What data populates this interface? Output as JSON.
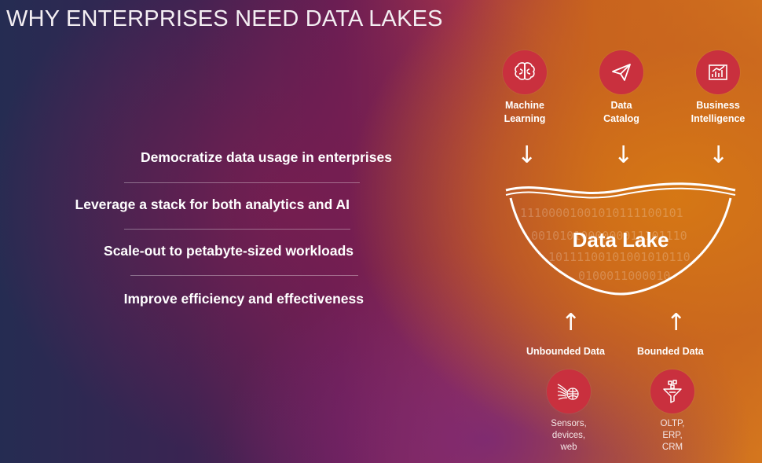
{
  "slide": {
    "title": "WHY ENTERPRISES NEED DATA LAKES"
  },
  "bullets": [
    "Democratize data usage in enterprises",
    "Leverage a stack for both analytics and AI",
    "Scale-out to petabyte-sized workloads",
    "Improve efficiency and effectiveness"
  ],
  "consumers": [
    {
      "line1": "Machine",
      "line2": "Learning",
      "icon": "brain-icon"
    },
    {
      "line1": "Data",
      "line2": "Catalog",
      "icon": "paper-plane-icon"
    },
    {
      "line1": "Business",
      "line2": "Intelligence",
      "icon": "bar-chart-icon"
    }
  ],
  "lake": {
    "label": "Data Lake",
    "binary_rows": [
      "11100001001010111100101",
      "0010101000000011101110",
      "10111100101001010110",
      "0100011000010"
    ]
  },
  "sources": {
    "unbounded": {
      "label": "Unbounded Data",
      "icon": "sensor-globe-icon",
      "caption1": "Sensors,",
      "caption2": "devices,",
      "caption3": "web"
    },
    "bounded": {
      "label": "Bounded Data",
      "icon": "funnel-icon",
      "caption1": "OLTP,",
      "caption2": "ERP,",
      "caption3": "CRM"
    }
  },
  "colors": {
    "accent": "#c9303e"
  }
}
